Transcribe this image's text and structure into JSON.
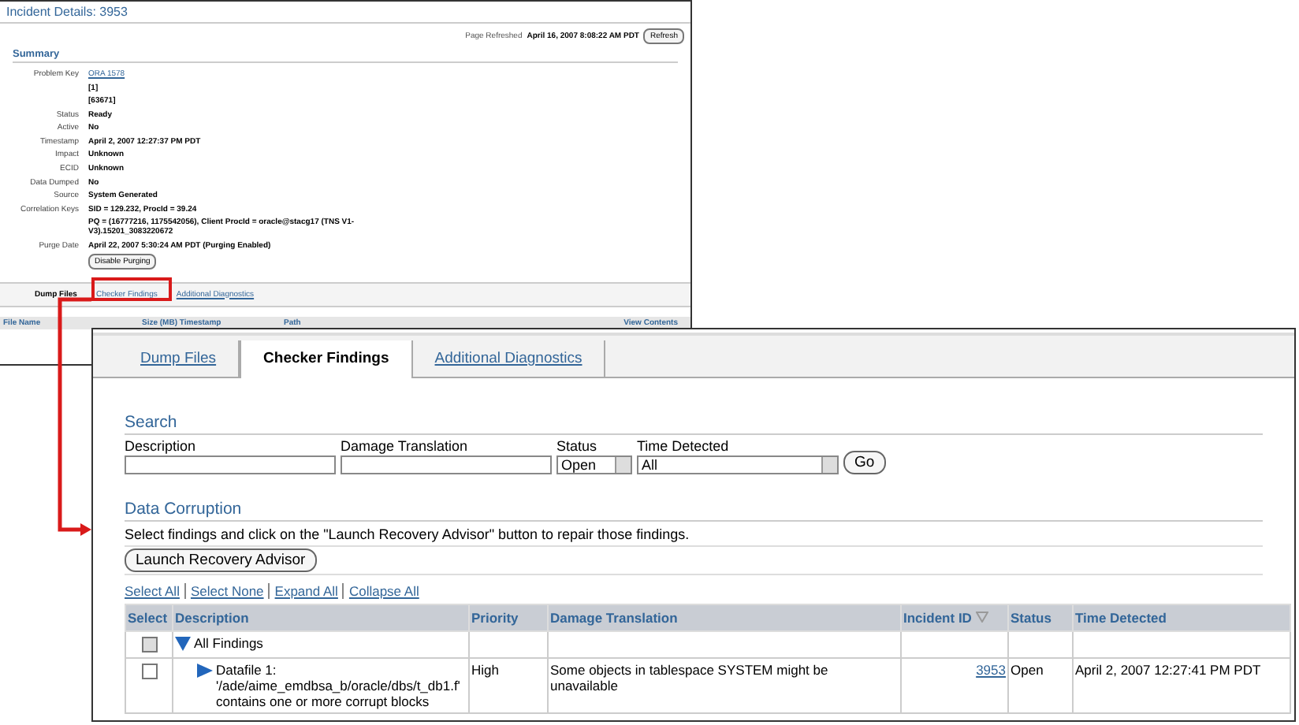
{
  "back_window": {
    "title": "Incident Details: 3953",
    "refreshed_label": "Page Refreshed",
    "refreshed_time": "April 16, 2007 8:08:22 AM PDT",
    "refresh_button": "Refresh",
    "summary_heading": "Summary",
    "fields": [
      {
        "label": "Problem Key",
        "values": [
          {
            "text": "ORA 1578",
            "kind": "link"
          },
          {
            "text": "[1]",
            "kind": "bold"
          },
          {
            "text": "[63671]",
            "kind": "bold"
          }
        ]
      },
      {
        "label": "Status",
        "values": [
          {
            "text": "Ready",
            "kind": "bold"
          }
        ]
      },
      {
        "label": "Active",
        "values": [
          {
            "text": "No",
            "kind": "bold"
          }
        ]
      },
      {
        "label": "Timestamp",
        "values": [
          {
            "text": "April 2, 2007 12:27:37 PM PDT",
            "kind": "bold"
          }
        ]
      },
      {
        "label": "Impact",
        "values": [
          {
            "text": "Unknown",
            "kind": "bold"
          }
        ]
      },
      {
        "label": "ECID",
        "values": [
          {
            "text": "Unknown",
            "kind": "bold"
          }
        ]
      },
      {
        "label": "Data Dumped",
        "values": [
          {
            "text": "No",
            "kind": "bold"
          }
        ]
      },
      {
        "label": "Source",
        "values": [
          {
            "text": "System Generated",
            "kind": "bold"
          }
        ]
      },
      {
        "label": "Correlation Keys",
        "values": [
          {
            "text": "SID = 129.232, ProcId = 39.24",
            "kind": "bold"
          },
          {
            "text": "PQ = (16777216, 1175542056), Client ProcId = oracle@stacg17 (TNS V1-V3).15201_3083220672",
            "kind": "bold"
          }
        ]
      },
      {
        "label": "Purge Date",
        "values": [
          {
            "text": "April 22, 2007 5:30:24 AM PDT (Purging Enabled)",
            "kind": "bold"
          }
        ],
        "button": "Disable Purging"
      }
    ],
    "tabs": [
      {
        "label": "Dump Files",
        "selected": true
      },
      {
        "label": "Checker Findings",
        "selected": false
      },
      {
        "label": "Additional Diagnostics",
        "selected": false
      }
    ],
    "file_table": {
      "columns": [
        "File Name",
        "Size (MB) Timestamp",
        "Path",
        "View Contents"
      ]
    }
  },
  "front_window": {
    "tabs": [
      {
        "label": "Dump Files",
        "selected": false
      },
      {
        "label": "Checker Findings",
        "selected": true
      },
      {
        "label": "Additional Diagnostics",
        "selected": false
      }
    ],
    "search": {
      "heading": "Search",
      "fields": [
        {
          "label": "Description",
          "kind": "text"
        },
        {
          "label": "Damage Translation",
          "kind": "text"
        },
        {
          "label": "Status",
          "kind": "select",
          "value": "Open"
        },
        {
          "label": "Time Detected",
          "kind": "select",
          "value": "All"
        }
      ],
      "go_button": "Go"
    },
    "data_corruption": {
      "heading": "Data Corruption",
      "instruction": "Select findings and click on the \"Launch Recovery Advisor\" button to repair those findings.",
      "button": "Launch Recovery Advisor",
      "links": [
        "Select All",
        "Select None",
        "Expand All",
        "Collapse All"
      ],
      "table": {
        "columns": [
          {
            "label": "Select",
            "sortable": false
          },
          {
            "label": "Description",
            "sortable": false
          },
          {
            "label": "Priority",
            "sortable": false
          },
          {
            "label": "Damage Translation",
            "sortable": false
          },
          {
            "label": "Incident ID",
            "sortable": true
          },
          {
            "label": "Status",
            "sortable": false
          },
          {
            "label": "Time Detected",
            "sortable": false
          }
        ],
        "rows": [
          {
            "description": "All Findings",
            "checked": false,
            "disabled": true,
            "expanded": true,
            "children": [
              {
                "description": "Datafile 1: '/ade/aime_emdbsa_b/oracle/dbs/t_db1.f' contains one or more corrupt blocks",
                "checked": false,
                "disabled": false,
                "expanded": false,
                "priority": "High",
                "damage_translation": "Some objects in tablespace SYSTEM might be unavailable",
                "incident_id": "3953",
                "status": "Open",
                "time_detected": "April 2, 2007 12:27:41 PM PDT"
              }
            ]
          }
        ]
      }
    }
  }
}
